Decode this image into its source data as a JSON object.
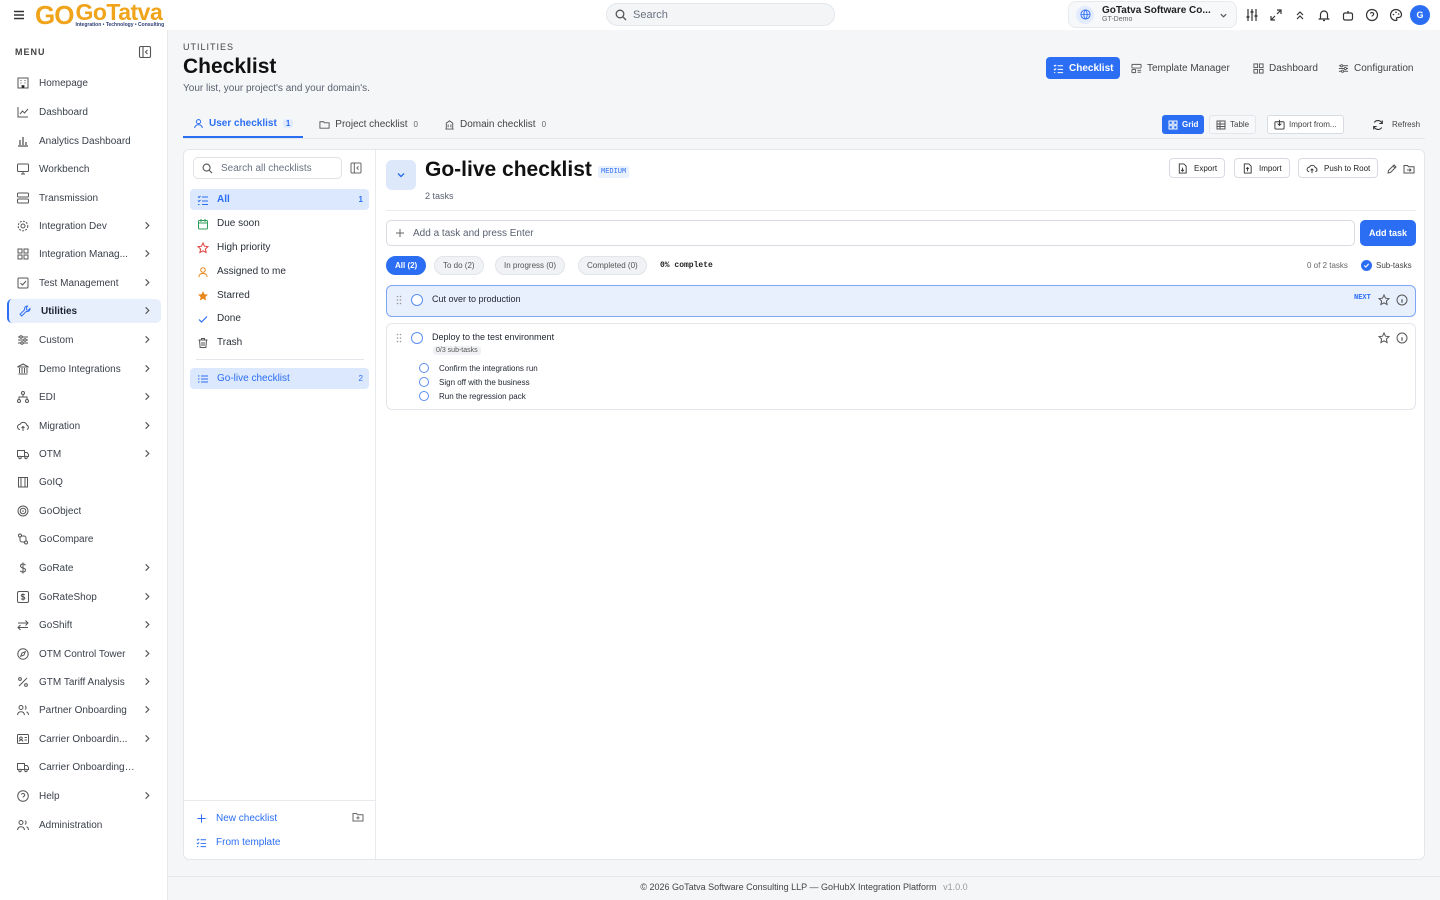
{
  "topbar": {
    "logo_go": "GO",
    "logo_name": "GoTatva",
    "logo_tagline": "Integration • Technology • Consulting",
    "search_placeholder": "Search",
    "org_name": "GoTatva Software Co...",
    "org_env": "GT-Demo",
    "avatar_initial": "G",
    "icons": [
      "menu-icon",
      "search-icon",
      "globe-icon",
      "chevron-down-icon",
      "sliders-icon",
      "expand-icon",
      "chevrons-up-icon",
      "bell-icon",
      "robot-icon",
      "help-icon",
      "palette-icon"
    ]
  },
  "sidebar": {
    "menu_label": "MENU",
    "items": [
      {
        "label": "Homepage",
        "icon": "building-icon",
        "submenu": false
      },
      {
        "label": "Dashboard",
        "icon": "chart-line-icon",
        "submenu": false
      },
      {
        "label": "Analytics Dashboard",
        "icon": "chart-bar-icon",
        "submenu": false
      },
      {
        "label": "Workbench",
        "icon": "monitor-icon",
        "submenu": false
      },
      {
        "label": "Transmission",
        "icon": "server-icon",
        "submenu": false
      },
      {
        "label": "Integration Dev",
        "icon": "gear-icon",
        "submenu": true
      },
      {
        "label": "Integration Manag...",
        "icon": "grid-icon",
        "submenu": true
      },
      {
        "label": "Test Management",
        "icon": "checkbox-icon",
        "submenu": true
      },
      {
        "label": "Utilities",
        "icon": "wrench-icon",
        "submenu": true,
        "active": true
      },
      {
        "label": "Custom",
        "icon": "sliders-icon",
        "submenu": true
      },
      {
        "label": "Demo Integrations",
        "icon": "bank-icon",
        "submenu": true
      },
      {
        "label": "EDI",
        "icon": "network-icon",
        "submenu": true
      },
      {
        "label": "Migration",
        "icon": "cloud-upload-icon",
        "submenu": true
      },
      {
        "label": "OTM",
        "icon": "truck-icon",
        "submenu": true
      },
      {
        "label": "GoIQ",
        "icon": "library-icon",
        "submenu": false
      },
      {
        "label": "GoObject",
        "icon": "target-icon",
        "submenu": false
      },
      {
        "label": "GoCompare",
        "icon": "git-compare-icon",
        "submenu": false
      },
      {
        "label": "GoRate",
        "icon": "dollar-icon",
        "submenu": true
      },
      {
        "label": "GoRateShop",
        "icon": "dollar-square-icon",
        "submenu": true
      },
      {
        "label": "GoShift",
        "icon": "arrows-icon",
        "submenu": true
      },
      {
        "label": "OTM Control Tower",
        "icon": "compass-icon",
        "submenu": true
      },
      {
        "label": "GTM Tariff Analysis",
        "icon": "percent-icon",
        "submenu": true
      },
      {
        "label": "Partner Onboarding",
        "icon": "users-icon",
        "submenu": true
      },
      {
        "label": "Carrier Onboardin...",
        "icon": "id-card-icon",
        "submenu": true
      },
      {
        "label": "Carrier Onboarding Po...",
        "icon": "truck-icon",
        "submenu": false
      },
      {
        "label": "Help",
        "icon": "help-icon",
        "submenu": true
      },
      {
        "label": "Administration",
        "icon": "users-icon",
        "submenu": false
      }
    ]
  },
  "header": {
    "crumb": "UTILITIES",
    "title": "Checklist",
    "subtitle": "Your list, your project's and your domain's.",
    "nav": [
      {
        "label": "Checklist",
        "active": true
      },
      {
        "label": "Template Manager"
      },
      {
        "label": "Dashboard"
      },
      {
        "label": "Configuration"
      }
    ]
  },
  "tabs": [
    {
      "label": "User checklist",
      "count": "1",
      "active": true
    },
    {
      "label": "Project checklist",
      "count": "0"
    },
    {
      "label": "Domain checklist",
      "count": "0"
    }
  ],
  "view": {
    "grid": "Grid",
    "table": "Table",
    "import": "Import from...",
    "refresh": "Refresh"
  },
  "lists": {
    "search_placeholder": "Search all checklists",
    "filters": [
      {
        "label": "All",
        "count": "1",
        "active": true
      },
      {
        "label": "Due soon"
      },
      {
        "label": "High priority"
      },
      {
        "label": "Assigned to me"
      },
      {
        "label": "Starred"
      },
      {
        "label": "Done"
      },
      {
        "label": "Trash"
      }
    ],
    "checklists": [
      {
        "label": "Go-live checklist",
        "count": "2",
        "active": true
      }
    ],
    "new_checklist": "New checklist",
    "from_template": "From template"
  },
  "detail": {
    "title": "Go-live checklist",
    "priority": "MEDIUM",
    "task_count": "2 tasks",
    "actions": {
      "export": "Export",
      "import": "Import",
      "push": "Push to Root"
    },
    "add_placeholder": "Add a task and press Enter",
    "add_button": "Add task",
    "filters": [
      "All (2)",
      "To do (2)",
      "In progress (0)",
      "Completed (0)"
    ],
    "percent": "0% complete",
    "completed_count": "0 of 2 tasks",
    "subtasks_toggle": "Sub-tasks",
    "tasks": [
      {
        "title": "Cut over to production",
        "next": "NEXT"
      },
      {
        "title": "Deploy to the test environment",
        "subtask_badge": "0/3 sub-tasks",
        "subtasks": [
          "Confirm the integrations run",
          "Sign off with the business",
          "Run the regression pack"
        ]
      }
    ]
  },
  "footer": {
    "text": "© 2026 GoTatva Software Consulting LLP — GoHubX Integration Platform",
    "version": "v1.0.0"
  },
  "colors": {
    "accent": "#2b6ef3",
    "brand": "#f0a41b"
  }
}
